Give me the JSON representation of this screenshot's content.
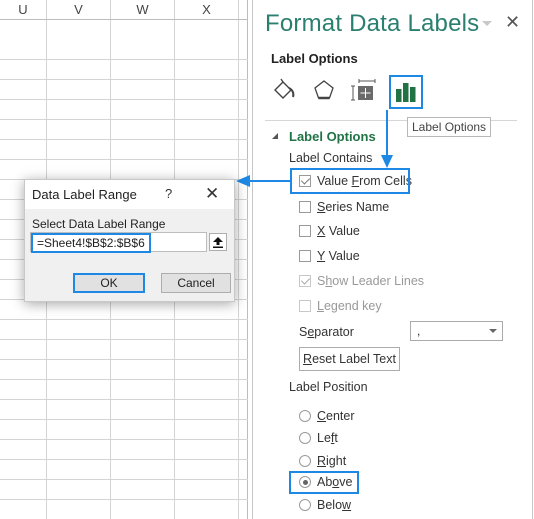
{
  "sheet": {
    "columns": [
      "U",
      "V",
      "W",
      "X"
    ]
  },
  "panel": {
    "title": "Format Data Labels",
    "section": "Label Options",
    "tabs": [
      {
        "name": "fill-line",
        "icon": "paint-bucket-icon"
      },
      {
        "name": "effects",
        "icon": "pentagon-icon"
      },
      {
        "name": "size-properties",
        "icon": "size-properties-icon"
      },
      {
        "name": "label-options",
        "icon": "bar-chart-icon",
        "selected": true
      }
    ],
    "tooltip": "Label Options",
    "group_title": "Label Options",
    "label_contains": "Label Contains",
    "checkboxes": [
      {
        "pre": "Value ",
        "key": "F",
        "post": "rom Cells",
        "checked": true,
        "disabled": false
      },
      {
        "pre": "",
        "key": "S",
        "post": "eries Name",
        "checked": false,
        "disabled": false
      },
      {
        "pre": "",
        "key": "X",
        "post": " Value",
        "checked": false,
        "disabled": false
      },
      {
        "pre": "",
        "key": "Y",
        "post": " Value",
        "checked": false,
        "disabled": false
      },
      {
        "pre": "S",
        "key": "h",
        "post": "ow Leader Lines",
        "checked": true,
        "disabled": true
      },
      {
        "pre": "",
        "key": "L",
        "post": "egend key",
        "checked": false,
        "disabled": true
      }
    ],
    "separator": {
      "pre": "S",
      "key": "e",
      "post": "parator",
      "value": ","
    },
    "reset": {
      "pre": "",
      "key": "R",
      "post": "eset Label Text"
    },
    "label_position": "Label Position",
    "positions": [
      {
        "pre": "",
        "key": "C",
        "post": "enter",
        "selected": false
      },
      {
        "pre": "Le",
        "key": "f",
        "post": "t",
        "selected": false
      },
      {
        "pre": "",
        "key": "R",
        "post": "ight",
        "selected": false
      },
      {
        "pre": "Ab",
        "key": "o",
        "post": "ve",
        "selected": true
      },
      {
        "pre": "Belo",
        "key": "w",
        "post": "",
        "selected": false
      }
    ]
  },
  "dialog": {
    "title": "Data Label Range",
    "help": "?",
    "close": "✕",
    "prompt": "Select Data Label Range",
    "range_value": "=Sheet4!$B$2:$B$6",
    "ok": "OK",
    "cancel": "Cancel"
  },
  "colors": {
    "accent_highlight": "#1e88e5",
    "title_teal": "#2a7f6f",
    "excel_green": "#217346"
  }
}
